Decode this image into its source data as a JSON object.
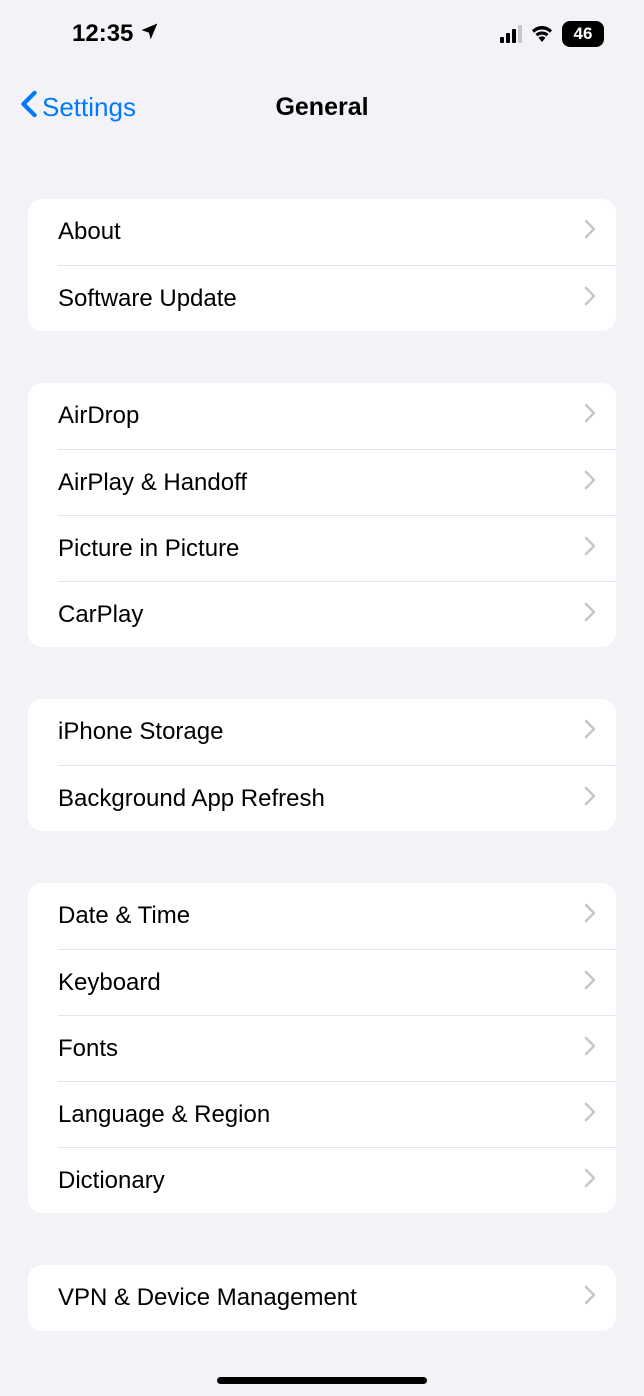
{
  "status": {
    "time": "12:35",
    "battery": "46"
  },
  "nav": {
    "back_label": "Settings",
    "title": "General"
  },
  "sections": [
    {
      "rows": [
        "About",
        "Software Update"
      ]
    },
    {
      "rows": [
        "AirDrop",
        "AirPlay & Handoff",
        "Picture in Picture",
        "CarPlay"
      ]
    },
    {
      "rows": [
        "iPhone Storage",
        "Background App Refresh"
      ]
    },
    {
      "rows": [
        "Date & Time",
        "Keyboard",
        "Fonts",
        "Language & Region",
        "Dictionary"
      ]
    },
    {
      "rows": [
        "VPN & Device Management"
      ]
    }
  ]
}
